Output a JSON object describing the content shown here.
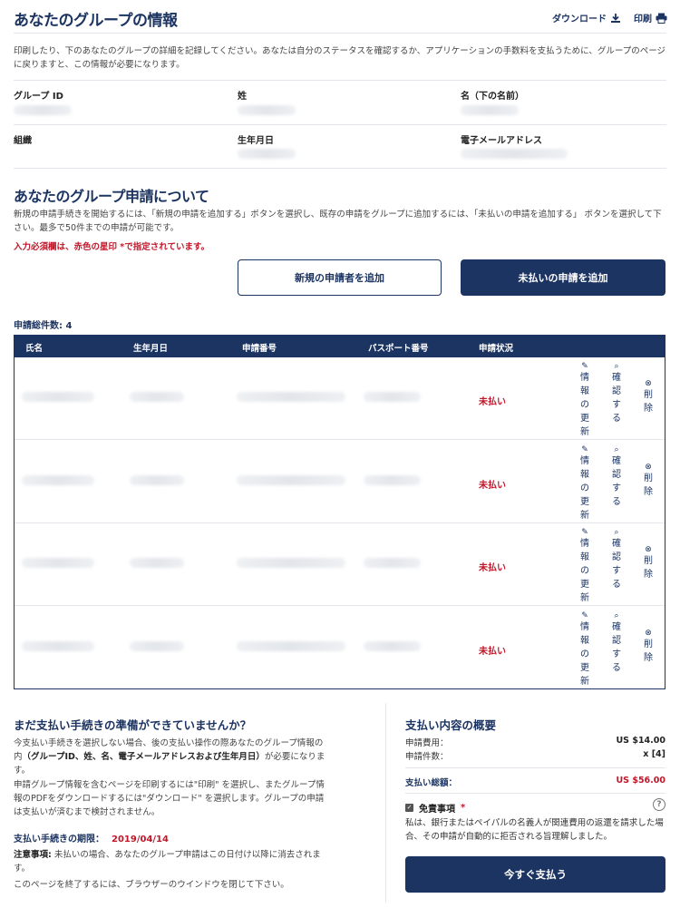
{
  "header": {
    "title": "あなたのグループの情報",
    "download_label": "ダウンロード",
    "print_label": "印刷",
    "intro": "印刷したり、下のあなたのグループの詳細を記録してください。あなたは自分のステータスを確認するか、アプリケーションの手数料を支払うために、グループのページに戻りますと、この情報が必要になります。"
  },
  "group_info": {
    "group_id_label": "グループ ID",
    "last_name_label": "姓",
    "first_name_label": "名（下の名前）",
    "organization_label": "組織",
    "dob_label": "生年月日",
    "email_label": "電子メールアドレス"
  },
  "application": {
    "title": "あなたのグループ申請について",
    "description": "新規の申請手続きを開始するには、「新規の申請を追加する」ボタンを選択し、既存の申請をグループに追加するには、「未払いの申請を追加する」 ボタンを選択して下さい。最多で50件までの申請が可能です。",
    "required_note": "入力必須欄は、赤色の星印 *で指定されています。",
    "add_new_label": "新規の申請者を追加",
    "add_unpaid_label": "未払いの申請を追加",
    "count_label": "申請総件数: 4"
  },
  "table": {
    "headers": [
      "氏名",
      "生年月日",
      "申請番号",
      "パスポート番号",
      "申請状況"
    ],
    "rows": [
      {
        "status": "未払い"
      },
      {
        "status": "未払い"
      },
      {
        "status": "未払い"
      },
      {
        "status": "未払い"
      }
    ],
    "actions": {
      "edit": "情報の更新",
      "view": "確認する",
      "delete": "削除"
    }
  },
  "not_ready": {
    "title": "まだ支払い手続きの準備ができていませんか？",
    "p1_a": "今支払い手続きを選択しない場合、後の支払い操作の際あなたのグループ情報の内",
    "p1_bold": "（グループID、姓、名、電子メールアドレスおよび生年月日）",
    "p1_b": "が必要になります。",
    "p2": "申請グループ情報を含むページを印刷するには\"印刷\" を選択し、またグループ情報のPDFをダウンロードするには\"ダウンロード\" を選択します。グループの申請は支払いが済むまで検討されません。",
    "deadline_label": "支払い手続きの期限：",
    "deadline_value": "2019/04/14",
    "note_label": "注意事項:",
    "note_text": " 未払いの場合、あなたのグループ申請はこの日付け以降に消去されます。",
    "close_text": "このページを終了するには、ブラウザーのウインドウを閉じて下さい。"
  },
  "summary": {
    "title": "支払い内容の概要",
    "fee_label": "申請費用：",
    "fee_value": "US $14.00",
    "count_label": "申請件数：",
    "count_value": "x [4]",
    "total_label": "支払い総額：",
    "total_value": "US $56.00",
    "disclaimer_label": "免責事項",
    "required_mark": "*",
    "disclaimer_text": "私は、銀行またはペイパルの名義人が関連費用の返還を請求した場合、その申請が自動的に拒否される旨理解しました。",
    "pay_label": "今すぐ支払う"
  },
  "colors": {
    "primary": "#1c3461",
    "error": "#c0182b"
  },
  "icons": [
    "download-icon",
    "print-icon",
    "pencil-icon",
    "search-icon",
    "close-circle-icon",
    "checkbox-icon",
    "help-icon"
  ]
}
